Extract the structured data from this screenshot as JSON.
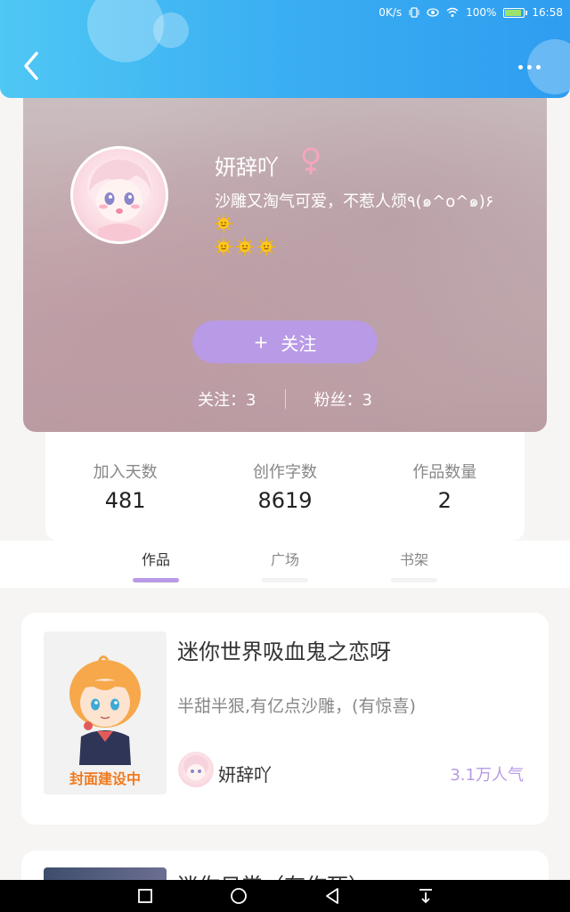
{
  "status_bar": {
    "speed": "0K/s",
    "battery": "100%",
    "time": "16:58"
  },
  "header": {
    "back_icon": "chevron-left-icon",
    "more_icon": "more-dots-icon"
  },
  "profile": {
    "username": "妍辞吖",
    "gender_symbol": "♀",
    "bio": "沙雕又淘气可爱，不惹人烦٩(๑^o^๑)۶",
    "follow_plus": "+",
    "follow_label": "关注",
    "following": "关注：3",
    "followers": "粉丝：3",
    "colors": {
      "accent": "#b89ae6",
      "gender": "#f4a6bd"
    }
  },
  "stats": {
    "join_days_label": "加入天数",
    "join_days_value": "481",
    "words_label": "创作字数",
    "words_value": "8619",
    "works_label": "作品数量",
    "works_value": "2"
  },
  "tabs": [
    {
      "label": "作品",
      "active": true
    },
    {
      "label": "广场",
      "active": false
    },
    {
      "label": "书架",
      "active": false
    }
  ],
  "works": [
    {
      "title": "迷你世界吸血鬼之恋呀",
      "description": "半甜半狠,有亿点沙雕，(有惊喜)",
      "cover_label": "封面建设中",
      "author": "妍辞吖",
      "popularity": "3.1万人气"
    },
    {
      "title": "迷你日常（有作死）"
    }
  ]
}
